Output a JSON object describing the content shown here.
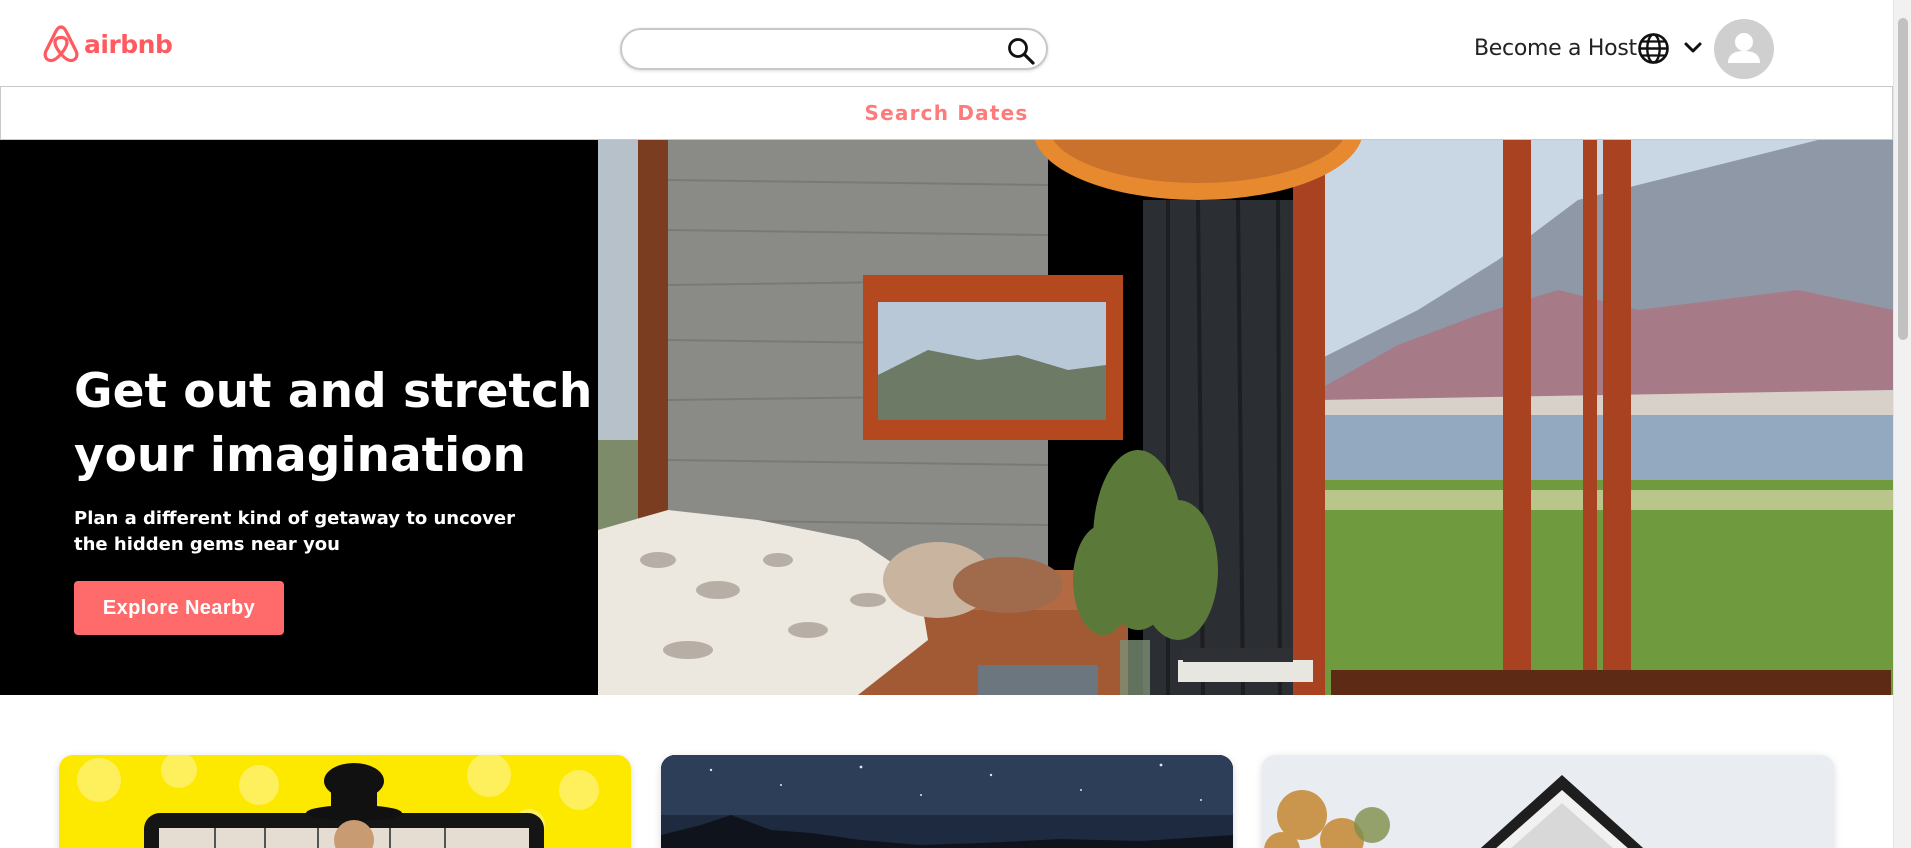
{
  "header": {
    "logo_text": "airbnb",
    "search_value": "",
    "search_placeholder": "",
    "become_host_label": "Become a Host",
    "icons": [
      "airbnb-logo-icon",
      "search-icon",
      "globe-icon",
      "chevron-down-icon",
      "user-avatar-icon"
    ]
  },
  "dates_bar": {
    "label": "Search Dates"
  },
  "hero": {
    "title_line1": "Get out and stretch",
    "title_line2": "your imagination",
    "subtitle": "Plan a different kind of getaway to uncover the hidden gems near you",
    "cta_label": "Explore Nearby",
    "photo_description_icon": "living-room-lake-view-photo"
  },
  "cards": [
    {
      "name": "online-experiences-card",
      "color": "#fde800"
    },
    {
      "name": "night-sky-card",
      "color": "#1d2a3f"
    },
    {
      "name": "cabin-card",
      "color": "#e7e9ee"
    }
  ],
  "colors": {
    "brand": "#ff5a5f",
    "accent_button": "#ff6b6b",
    "dates_text": "#ff7a7a",
    "hero_bg": "#000000"
  }
}
